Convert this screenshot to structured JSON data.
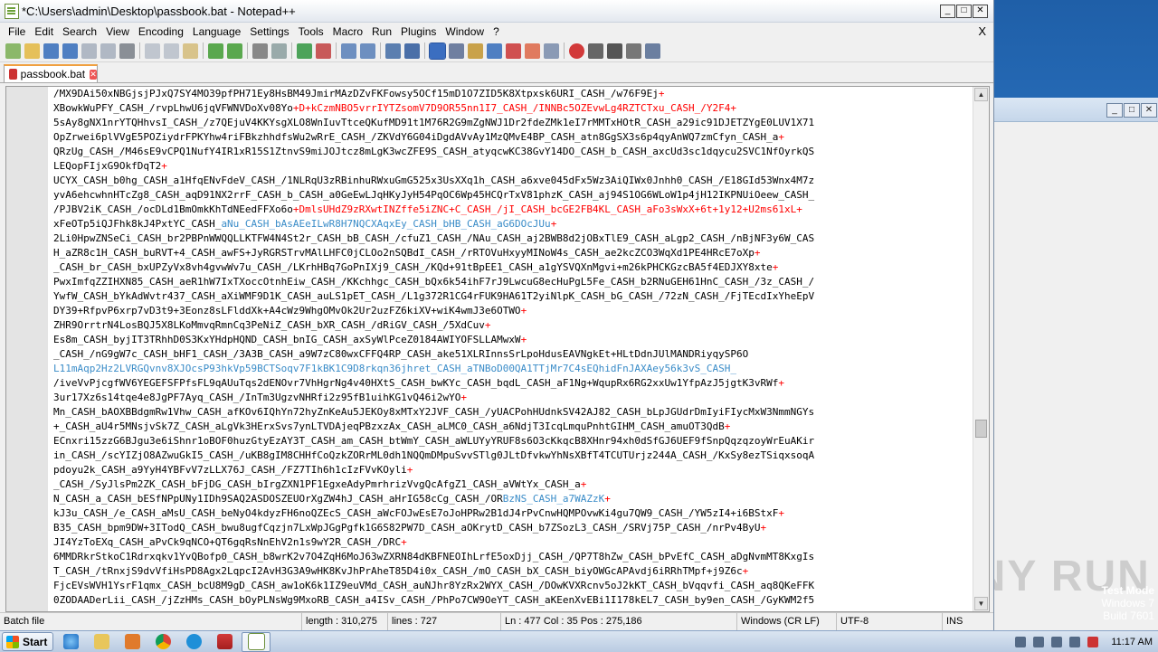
{
  "window": {
    "title": "*C:\\Users\\admin\\Desktop\\passbook.bat - Notepad++",
    "controls": {
      "minimize": "_",
      "maximize": "□",
      "close": "✕"
    }
  },
  "menu": [
    "File",
    "Edit",
    "Search",
    "View",
    "Encoding",
    "Language",
    "Settings",
    "Tools",
    "Macro",
    "Run",
    "Plugins",
    "Window",
    "?"
  ],
  "menu_close": "X",
  "tab": {
    "label": "passbook.bat",
    "close": "✕"
  },
  "editor_lines": [
    {
      "text": "/MX9DAi50xNBGjsjPJxQ7SY4MO39pfPH71Ey8HsBM49JmirMAzDZvFKFowsy5OCf15mD1O7ZID5K8Xtpxsk6URI_CASH_/w76F9Ej",
      "tail": "+"
    },
    {
      "text": "XBowkWuPFY_CASH_/rvpLhwU6jqVFWNVDoXv08Yo",
      "tail": "+D+kCzmNBO5vrrIYTZsomV7D9OR55nn1I7_CASH_/INNBc5OZEvwLg4RZTCTxu_CASH_/Y2F4+"
    },
    {
      "text": "5sAy8gNX1nrYTQHhvsI_CASH_/z7QEjuV4KKYsgXLO8WnIuvTtceQKufMD91t1M76R2G9mZgNWJ1Dr2fdeZMk1eI7rMMTxHOtR_CASH_a29ic91DJETZYgE0LUV1X71",
      "tail": ""
    },
    {
      "text": "OpZrwei6plVVgE5POZiydrFPKYhw4riFBkzhhdfsWu2wRrE_CASH_/ZKVdY6G04iDgdAVvAy1MzQMvE4BP_CASH_atn8GgSX3s6p4qyAnWQ7zmCfyn_CASH_a",
      "tail": "+"
    },
    {
      "text": "QRzUg_CASH_/M46sE9vCPQ1NufY4IR1xR15S1ZtnvS9miJOJtcz8mLgK3wcZFE9S_CASH_atyqcwKC38GvY14DO_CASH_b_CASH_axcUd3sc1dqycu2SVC1NfOyrkQS",
      "tail": ""
    },
    {
      "text": "LEQopFIjxG9OkfDqT2",
      "tail": "+"
    },
    {
      "text": "UCYX_CASH_b0hg_CASH_a1HfqENvFdeV_CASH_/1NLRqU3zRBinhuRWxuGmG525x3UsXXq1h_CASH_a6xve045dFx5Wz3AiQIWx0Jnhh0_CASH_/E18GId53Wnx4M7z",
      "tail": ""
    },
    {
      "text": "yvA6ehcwhnHTcZg8_CASH_aqD91NX2rrF_CASH_b_CASH_a0GeEwLJqHKyJyH54PqOC6Wp45HCQrTxV81phzK_CASH_aj94S1OG6WLoW1p4jH12IKPNUiOeew_CASH_",
      "tail": ""
    },
    {
      "text": "/PJBV2iK_CASH_/ocDLd1BmOmkKhTdNEedFFXo6o",
      "tail": "+DmlsUHdZ9zRXwtINZffe5iZNC+C_CASH_/jI_CASH_bcGE2FB4KL_CASH_aFo3sWxX+6t+1y12+U2ms61xL+"
    },
    {
      "text": "xFeOTp5iQJFhk8kJ4PxtYC_CASH_",
      "tail": "",
      "hl": "aNu_CASH_bAsAEeILwR8H7NQCXAqxEy_CASH_bHB_CASH_aG6DOcJUu",
      "hltail": "+"
    },
    {
      "text": "2Li0HpwZNSeCi_CASH_br2PBPnWWQQLLKTFW4N4St2r_CASH_bB_CASH_/cfuZ1_CASH_/NAu_CASH_aj2BWB8d2jOBxTlE9_CASH_aLgp2_CASH_/nBjNF3y6W_CAS",
      "tail": ""
    },
    {
      "text": "H_aZR8c1H_CASH_buRVT+4_CASH_awFS+JyRGRSTrvMAlLHFC0jCLOo2nSQBdI_CASH_/rRTOVuHxyyMINoW4s_CASH_ae2kcZCO3WqXd1PE4HRcE7oXp",
      "tail": "+"
    },
    {
      "text": "_CASH_br_CASH_bxUPZyVx8vh4gvwWv7u_CASH_/LKrhHBq7GoPnIXj9_CASH_/KQd+91tBpEE1_CASH_a1gYSVQXnMgvi+m26kPHCKGzcBA5f4EDJXY8xte",
      "tail": "+"
    },
    {
      "text": "PwxImfqZZIHXN85_CASH_aeR1hW7IxTXoccOtnhEiw_CASH_/KKchhgc_CASH_bQx6k54ihF7rJ9LwcuG8ecHuPgL5Fe_CASH_b2RNuGEH61HnC_CASH_/3z_CASH_/",
      "tail": ""
    },
    {
      "text": "YwfW_CASH_bYkAdWvtr437_CASH_aXiWMF9D1K_CASH_auLS1pET_CASH_/L1g372R1CG4rFUK9HA61T2yiNlpK_CASH_bG_CASH_/72zN_CASH_/FjTEcdIxYheEpV",
      "tail": ""
    },
    {
      "text": "DY39+RfpvP6xrp7vD3t9+3Eonz8sLFlddXk+A4cWz9WhgOMvOk2Ur2uzFZ6kiXV+wiK4wmJ3e6OTWO",
      "tail": "+"
    },
    {
      "text": "ZHR9OrrtrN4LosBQJ5X8LKoMmvqRmnCq3PeNiZ_CASH_bXR_CASH_/dRiGV_CASH_/5XdCuv",
      "tail": "+"
    },
    {
      "text": "Es8m_CASH_byjIT3TRhhD0S3KxYHdpHQND_CASH_bnIG_CASH_axSyWlPceZ0184AWIYOFSLLAMwxW",
      "tail": "+"
    },
    {
      "text": "_CASH_/nG9gW7c_CASH_bHF1_CASH_/3A3B_CASH_a9W7zC80wxCFFQ4RP_CASH_ake51XLRInnsSrLpoHdusEAVNgkEt+HLtDdnJUlMANDRiyqySP6O",
      "tail": ""
    },
    {
      "text": "L11mAqp2Hz2LVRGQvnv8XJOcsP93hkVp59BCTSoqv7F1kBK1C9D8rkqn36jhret_CASH_aTNBoD00QA1TTjMr7C4sEQhidFnJAXAey56k3vS_CASH_",
      "tail": "",
      "blue": true
    },
    {
      "text": "/iveVvPjcgfWV6YEGEFSFPfsFL9qAUuTqs2dENOvr7VhHgrNg4v40HXtS_CASH_bwKYc_CASH_bqdL_CASH_aF1Ng+WqupRx6RG2xxUw1YfpAzJ5jgtK3vRWf",
      "tail": "+"
    },
    {
      "text": "3ur17Xz6s14tqe4e8JgPF7Ayq_CASH_/InTm3UgzvNHRfi2z95fB1uihKG1vQ46i2wYO",
      "tail": "+"
    },
    {
      "text": "Mn_CASH_bAOXBBdgmRw1Vhw_CASH_afKOv6IQhYn72hyZnKeAu5JEKOy8xMTxY2JVF_CASH_/yUACPohHUdnkSV42AJ82_CASH_bLpJGUdrDmIyiFIycMxW3NmmNGYs",
      "tail": ""
    },
    {
      "text": "+_CASH_aU4r5MNsjvSk7Z_CASH_aLgVk3HErxSvs7ynLTVDAjeqPBzxzAx_CASH_aLMC0_CASH_a6NdjT3IcqLmquPnhtGIHM_CASH_amuOT3QdB",
      "tail": "+"
    },
    {
      "text": "ECnxri15zzG6BJgu3e6iShnr1oBOF0huzGtyEzAY3T_CASH_am_CASH_btWmY_CASH_aWLUYyYRUF8s6O3cKkqcB8XHnr94xh0dSfGJ6UEF9fSnpQqzqzoyWrEuAKir",
      "tail": ""
    },
    {
      "text": "in_CASH_/scYIZjO8AZwuGkI5_CASH_/uKB8gIM8CHHfCoQzkZORrML0dh1NQQmDMpuSvvSTlg0JLtDfvkwYhNsXBfT4TCUTUrjz244A_CASH_/KxSy8ezTSiqxsoqA",
      "tail": ""
    },
    {
      "text": "pdoyu2k_CASH_a9YyH4YBFvV7zLLX76J_CASH_/FZ7TIh6h1cIzFVvKOyli",
      "tail": "+"
    },
    {
      "text": "_CASH_/SyJlsPm2ZK_CASH_bFjDG_CASH_bIrgZXN1PF1EgxeAdyPmrhrizVvgQcAfgZ1_CASH_aVWtYx_CASH_a",
      "tail": "+"
    },
    {
      "text": "N_CASH_a_CASH_bESfNPpUNy1IDh9SAQ2ASDOSZEUOrXgZW4hJ_CASH_aHrIG58cCg_CASH_/OR",
      "tail": "",
      "hl": "BzNS_CASH_a7WAZzK",
      "hltail": "+"
    },
    {
      "text": "kJ3u_CASH_/e_CASH_aMsU_CASH_beNyO4kdyzFH6noQZEcS_CASH_aWcFOJwEsE7oJoHPRw2B1dJ4rPvCnwHQMPOvwKi4gu7QW9_CASH_/YW5zI4+i6BStxF",
      "tail": "+"
    },
    {
      "text": "B35_CASH_bpm9DW+3ITodQ_CASH_bwu8ugfCqzjn7LxWpJGgPgfk1G6S82PW7D_CASH_aOKrytD_CASH_b7ZSozL3_CASH_/SRVj75P_CASH_/nrPv4ByU",
      "tail": "+"
    },
    {
      "text": "JI4YzToEXq_CASH_aPvCk9qNCO+QT6gqRsNnEhV2n1s9wY2R_CASH_/DRC",
      "tail": "+"
    },
    {
      "text": "6MMDRkrStkoC1Rdrxqkv1YvQBofp0_CASH_b8wrK2v7O4ZqH6MoJ63wZXRN84dKBFNEOIhLrfE5oxDjj_CASH_/QP7T8hZw_CASH_bPvEfC_CASH_aDgNvmMT8KxgIs",
      "tail": ""
    },
    {
      "text": "T_CASH_/tRnxjS9dvVfiHsPD8Agx2LqpcI2AvH3G3A9wHK8KvJhPrAheT85D4i0x_CASH_/mO_CASH_bX_CASH_biyOWGcAPAvdj6iRRhTMpf+j9Z6c",
      "tail": "+"
    },
    {
      "text": "FjcEVsWVH1YsrF1qmx_CASH_bcU8M9gD_CASH_aw1oK6k1IZ9euVMd_CASH_auNJhr8YzRx2WYX_CASH_/DOwKVXRcnv5oJ2kKT_CASH_bVqqvfi_CASH_aq8QKeFFK",
      "tail": ""
    },
    {
      "text": "0ZODAADerLii_CASH_/jZzHMs_CASH_bOyPLNsWg9MxoRB_CASH_a4ISv_CASH_/PhPo7CW9OeYT_CASH_aKEenXvEBi1I178kEL7_CASH_by9en_CASH_/GyKWM2f5",
      "tail": ""
    }
  ],
  "status": {
    "type": "Batch file",
    "length": "length : 310,275",
    "lines": "lines : 727",
    "position": "Ln : 477    Col : 35    Pos : 275,186",
    "eol": "Windows (CR LF)",
    "encoding": "UTF-8",
    "mode": "INS"
  },
  "taskbar": {
    "start": "Start",
    "clock": "11:17 AM"
  },
  "watermark": {
    "line1": "Test Mode",
    "line2": "Windows 7",
    "line3": "Build 7601",
    "brand": "ANY RUN"
  },
  "colors": {
    "operator": "#ff0000",
    "highlight": "#3a8cc8",
    "tab_accent": "#f0a040"
  }
}
